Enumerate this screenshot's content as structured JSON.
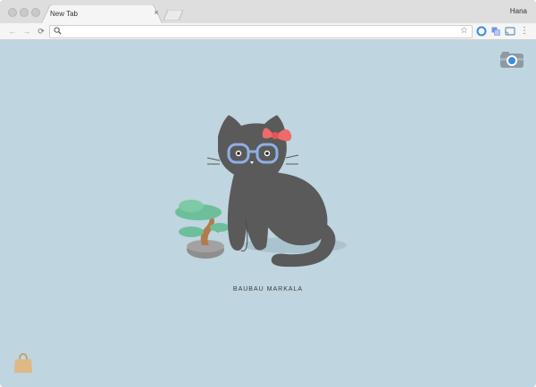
{
  "browser": {
    "tab": {
      "title": "New Tab",
      "close_glyph": "×"
    },
    "profile_name": "Hana",
    "omnibox": {
      "value": "",
      "placeholder": ""
    },
    "icons": {
      "back": "back-arrow-icon",
      "forward": "forward-arrow-icon",
      "reload": "reload-icon",
      "search": "search-icon",
      "star": "bookmark-star-icon",
      "ext1": "extension-o-icon",
      "ext2": "translate-icon",
      "ext3": "cast-icon",
      "menu": "menu-icon"
    },
    "glyphs": {
      "back": "←",
      "forward": "→",
      "reload": "⟳",
      "star": "☆",
      "menu": "⋮"
    }
  },
  "new_tab_page": {
    "caption": "BAUBAU MARKALA",
    "icons": {
      "camera": "camera-icon",
      "bag": "shopping-bag-icon"
    }
  },
  "colors": {
    "background": "#bfd5df",
    "cat": "#5a5a5a",
    "bow": "#f06a6a",
    "glasses": "#8fb0e6",
    "tree_leaves": "#6dbf9a",
    "tree_trunk": "#b37a4c",
    "pot": "#8e8e8e",
    "bag": "#e0b884"
  }
}
